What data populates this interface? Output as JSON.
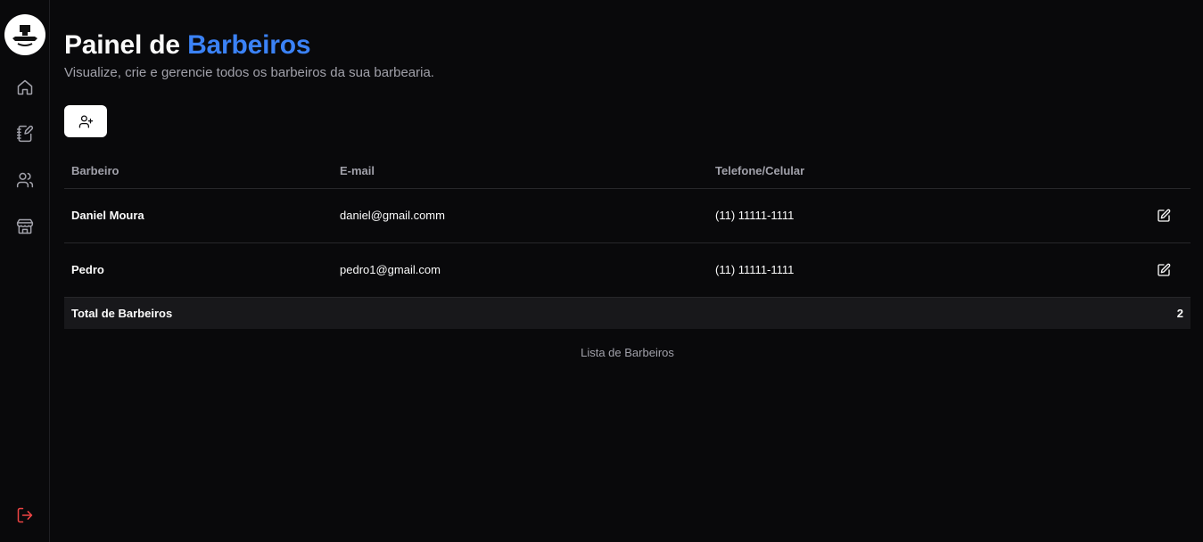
{
  "sidebar": {
    "logo_icon": "barbershop-logo-icon",
    "items": [
      {
        "icon": "home-icon"
      },
      {
        "icon": "notebook-edit-icon"
      },
      {
        "icon": "users-icon"
      },
      {
        "icon": "store-icon"
      }
    ],
    "logout_icon": "logout-icon"
  },
  "header": {
    "title_prefix": "Painel de ",
    "title_accent": "Barbeiros",
    "subtitle": "Visualize, crie e gerencie todos os barbeiros da sua barbearia."
  },
  "toolbar": {
    "add_icon": "user-plus-icon"
  },
  "table": {
    "columns": [
      "Barbeiro",
      "E-mail",
      "Telefone/Celular"
    ],
    "rows": [
      {
        "name": "Daniel Moura",
        "email": "daniel@gmail.comm",
        "phone": "(11) 11111-1111"
      },
      {
        "name": "Pedro",
        "email": "pedro1@gmail.com",
        "phone": "(11) 11111-1111"
      }
    ],
    "footer": {
      "label": "Total de Barbeiros",
      "count": "2"
    },
    "caption": "Lista de Barbeiros"
  },
  "colors": {
    "accent": "#3b82f6",
    "background": "#09090b",
    "logout": "#ef4444"
  }
}
